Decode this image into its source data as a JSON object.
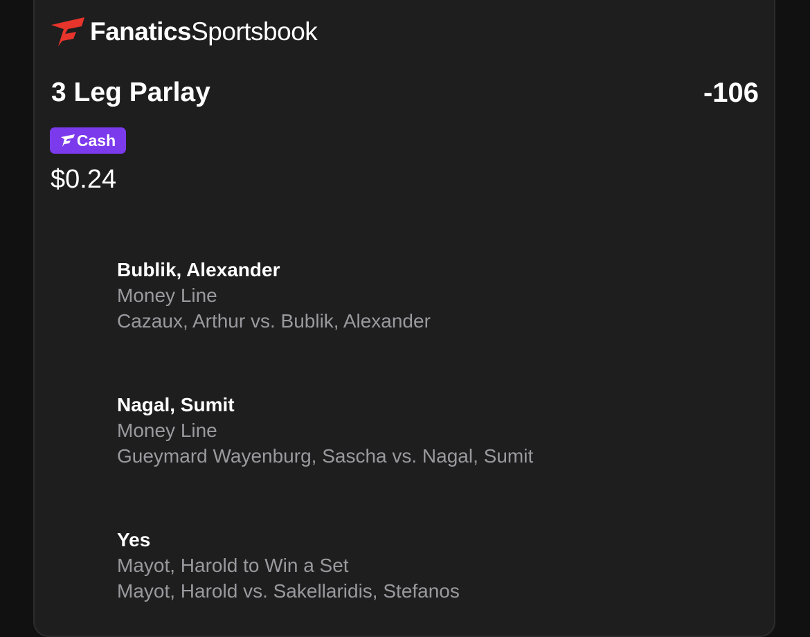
{
  "brand": {
    "name_bold": "Fanatics",
    "name_regular": "Sportsbook",
    "logo_icon": "fanatics-flag-icon",
    "logo_color": "#e8352b"
  },
  "bet": {
    "title": "3 Leg Parlay",
    "odds": "-106",
    "badge_label": "Cash",
    "badge_icon": "fanatics-f-icon",
    "badge_color": "#7c3aed",
    "stake": "$0.24"
  },
  "legs": [
    {
      "selection": "Bublik, Alexander",
      "market": "Money Line",
      "event": "Cazaux, Arthur vs. Bublik, Alexander"
    },
    {
      "selection": "Nagal, Sumit",
      "market": "Money Line",
      "event": "Gueymard Wayenburg, Sascha vs. Nagal, Sumit"
    },
    {
      "selection": "Yes",
      "market": "Mayot, Harold to Win a Set",
      "event": "Mayot, Harold vs. Sakellaridis, Stefanos"
    }
  ]
}
